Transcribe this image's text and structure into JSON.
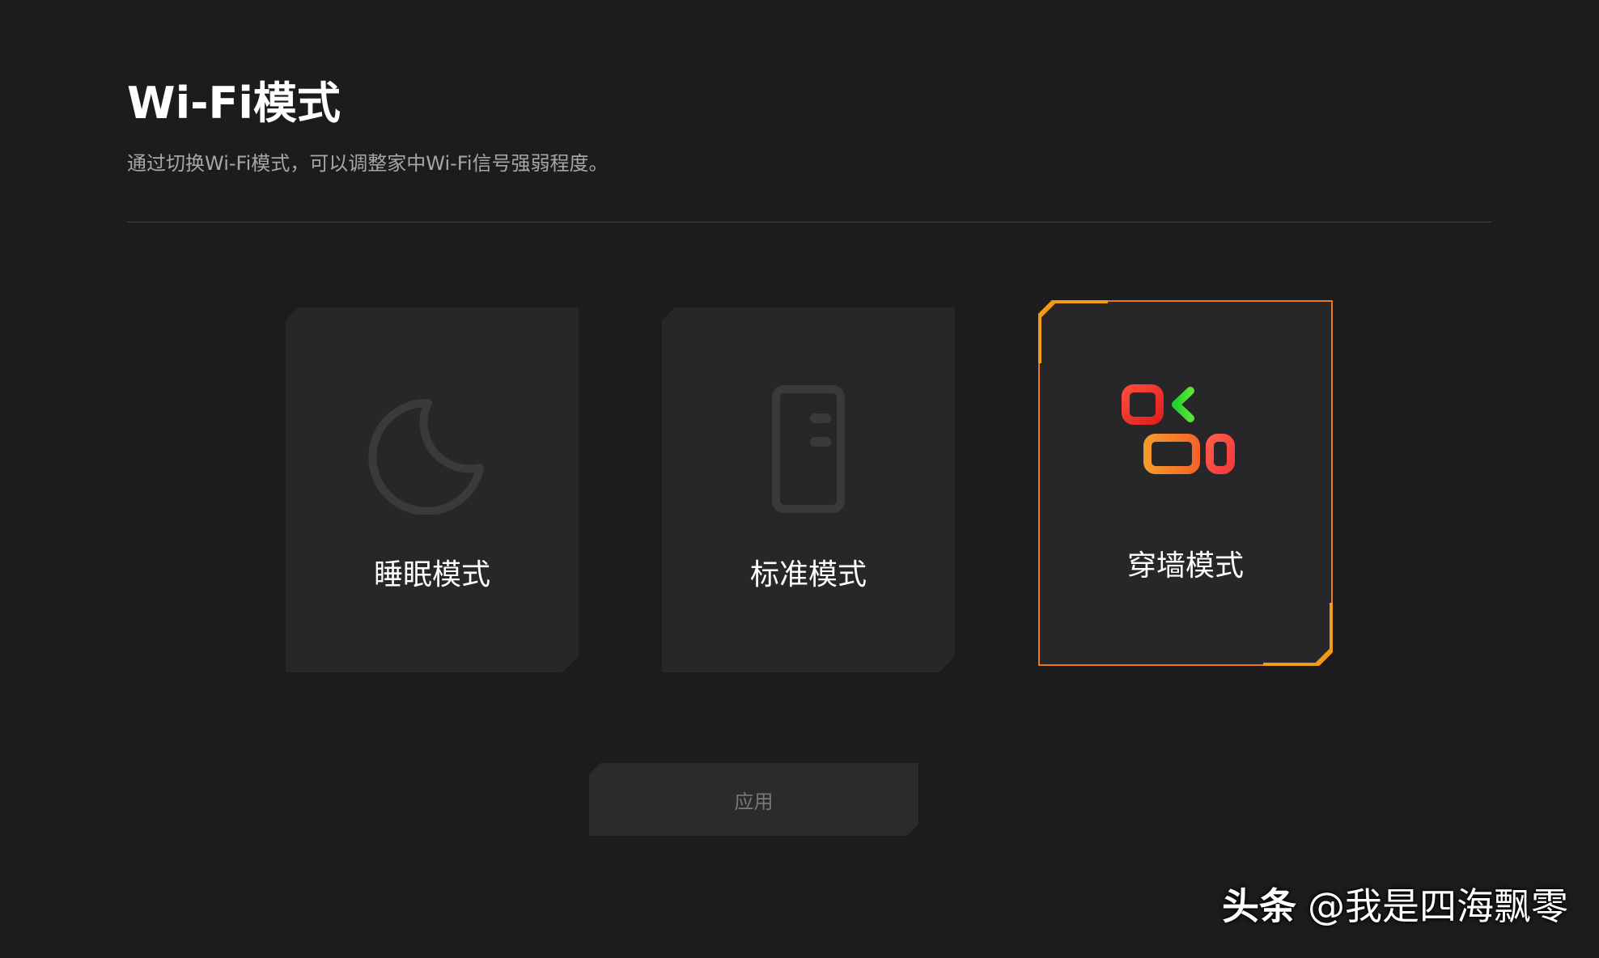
{
  "header": {
    "title": "Wi-Fi模式",
    "subtitle": "通过切换Wi-Fi模式，可以调整家中Wi-Fi信号强弱程度。"
  },
  "modes": [
    {
      "label": "睡眠模式",
      "icon": "moon-icon",
      "selected": false
    },
    {
      "label": "标准模式",
      "icon": "router-icon",
      "selected": false
    },
    {
      "label": "穿墙模式",
      "icon": "wall-penetration-icon",
      "selected": true
    }
  ],
  "apply_label": "应用",
  "watermark": {
    "brand": "头条",
    "handle": "@我是四海飘零"
  },
  "colors": {
    "background": "#1c1c1e",
    "card": "#27272a",
    "accent_orange": "#f08a24",
    "icon_red": "#f23a2f",
    "icon_orange": "#f7822a",
    "icon_green": "#2fd12f",
    "muted_icon": "#3a3a3d"
  }
}
